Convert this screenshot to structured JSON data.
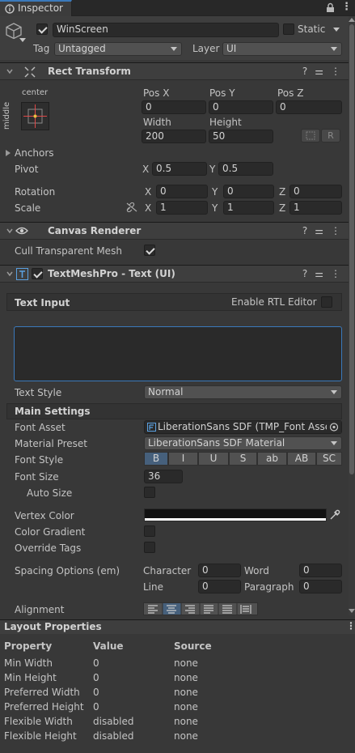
{
  "tab": {
    "label": "Inspector"
  },
  "object": {
    "name": "WinScreen",
    "static_label": "Static",
    "tag_label": "Tag",
    "tag_value": "Untagged",
    "layer_label": "Layer",
    "layer_value": "UI"
  },
  "rect_transform": {
    "title": "Rect Transform",
    "anchor_h": "center",
    "anchor_v": "middle",
    "pos_x_label": "Pos X",
    "pos_y_label": "Pos Y",
    "pos_z_label": "Pos Z",
    "pos_x": "0",
    "pos_y": "0",
    "pos_z": "0",
    "width_label": "Width",
    "height_label": "Height",
    "width": "200",
    "height": "50",
    "raw_edit": "R",
    "anchors_label": "Anchors",
    "pivot_label": "Pivot",
    "pivot_x": "0.5",
    "pivot_y": "0.5",
    "rotation_label": "Rotation",
    "rot_x": "0",
    "rot_y": "0",
    "rot_z": "0",
    "scale_label": "Scale",
    "scale_x": "1",
    "scale_y": "1",
    "scale_z": "1",
    "x": "X",
    "y": "Y",
    "z": "Z"
  },
  "canvas_renderer": {
    "title": "Canvas Renderer",
    "cull_label": "Cull Transparent Mesh",
    "cull_value": true
  },
  "tmp": {
    "title": "TextMeshPro - Text (UI)",
    "text_input_label": "Text Input",
    "rtl_label": "Enable RTL Editor",
    "text_value": "",
    "text_style_label": "Text Style",
    "text_style_value": "Normal",
    "main_settings": "Main Settings",
    "font_asset_label": "Font Asset",
    "font_asset_value": "LiberationSans SDF (TMP_Font Asset",
    "material_preset_label": "Material Preset",
    "material_preset_value": "LiberationSans SDF Material",
    "font_style_label": "Font Style",
    "font_styles": [
      "B",
      "I",
      "U",
      "S",
      "ab",
      "AB",
      "SC"
    ],
    "font_size_label": "Font Size",
    "font_size_value": "36",
    "auto_size_label": "Auto Size",
    "vertex_color_label": "Vertex Color",
    "color_gradient_label": "Color Gradient",
    "override_tags_label": "Override Tags",
    "spacing_label": "Spacing Options (em)",
    "character_label": "Character",
    "character_value": "0",
    "word_label": "Word",
    "word_value": "0",
    "line_label": "Line",
    "line_value": "0",
    "paragraph_label": "Paragraph",
    "paragraph_value": "0",
    "alignment_label": "Alignment"
  },
  "layout_properties": {
    "title": "Layout Properties",
    "columns": [
      "Property",
      "Value",
      "Source"
    ],
    "rows": [
      [
        "Min Width",
        "0",
        "none"
      ],
      [
        "Min Height",
        "0",
        "none"
      ],
      [
        "Preferred Width",
        "0",
        "none"
      ],
      [
        "Preferred Height",
        "0",
        "none"
      ],
      [
        "Flexible Width",
        "disabled",
        "none"
      ],
      [
        "Flexible Height",
        "disabled",
        "none"
      ]
    ]
  },
  "colors": {
    "accent": "#3a79bb",
    "selected_segment": "#46607c",
    "background": "#383838"
  }
}
